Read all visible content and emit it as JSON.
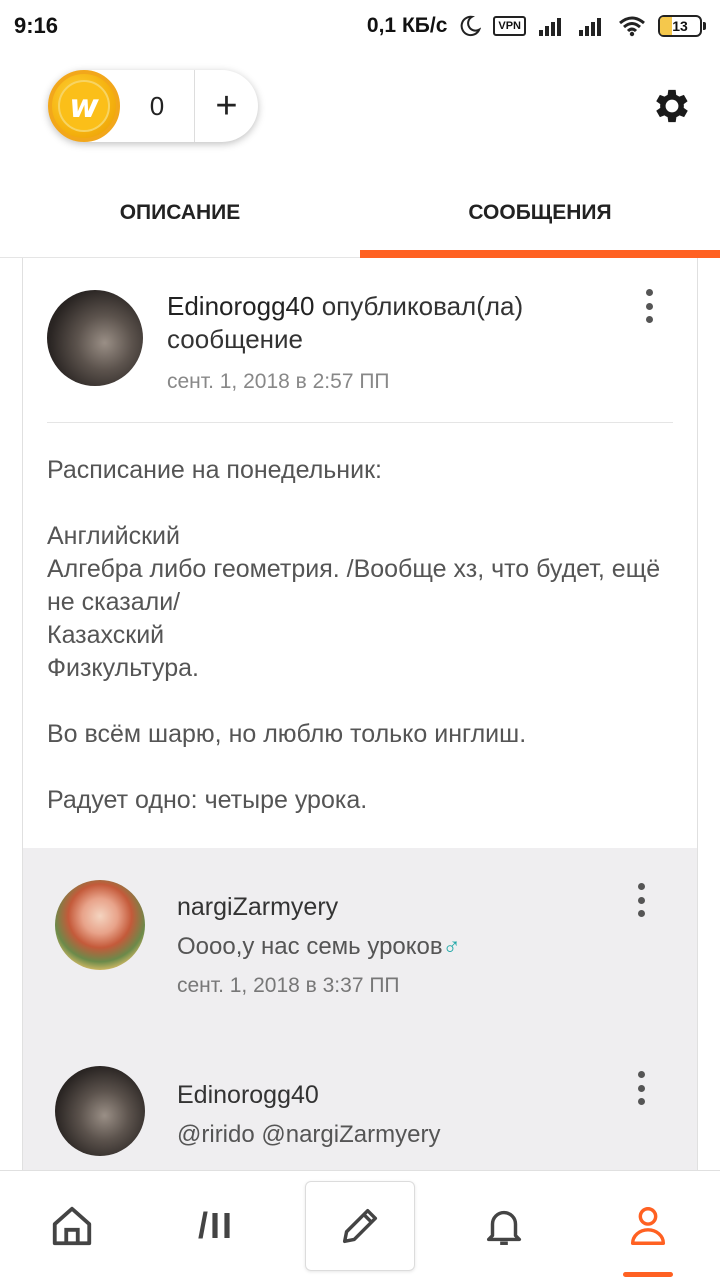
{
  "status_bar": {
    "time": "9:16",
    "speed": "0,1 КБ/с",
    "vpn": "VPN",
    "battery": "13"
  },
  "coins": {
    "count": "0",
    "plus": "+"
  },
  "tabs": [
    {
      "label": "ОПИСАНИЕ",
      "active": false
    },
    {
      "label": "СООБЩЕНИЯ",
      "active": true
    }
  ],
  "post": {
    "author": "Edinorogg40",
    "action": "опубликовал(ла) сообщение",
    "date": "сент. 1, 2018 в 2:57 ПП",
    "body": [
      "Расписание на понедельник:",
      "Английский\nАлгебра либо геометрия. /Вообще хз, что будет, ещё не сказали/\nКазахский\nФизкультура.",
      "Во всём шарю, но люблю только инглиш.",
      "Радует одно: четыре урока."
    ]
  },
  "comments": [
    {
      "author": "nargiZarmyery",
      "text": "Оооо,у нас семь уроков",
      "emoji": "♂",
      "date": "сент. 1, 2018 в 3:37 ПП"
    },
    {
      "author": "Edinorogg40",
      "text": "@rirido  @nargiZarmyery"
    }
  ],
  "bottom_nav": [
    {
      "icon": "home-icon",
      "active": false
    },
    {
      "icon": "library-icon",
      "label": "/II",
      "active": false
    },
    {
      "icon": "pencil-icon",
      "active": false
    },
    {
      "icon": "bell-icon",
      "active": false
    },
    {
      "icon": "profile-icon",
      "active": true
    }
  ],
  "colors": {
    "accent": "#ff6122",
    "coin": "#fbbf19",
    "comments_bg": "#efeef0"
  }
}
